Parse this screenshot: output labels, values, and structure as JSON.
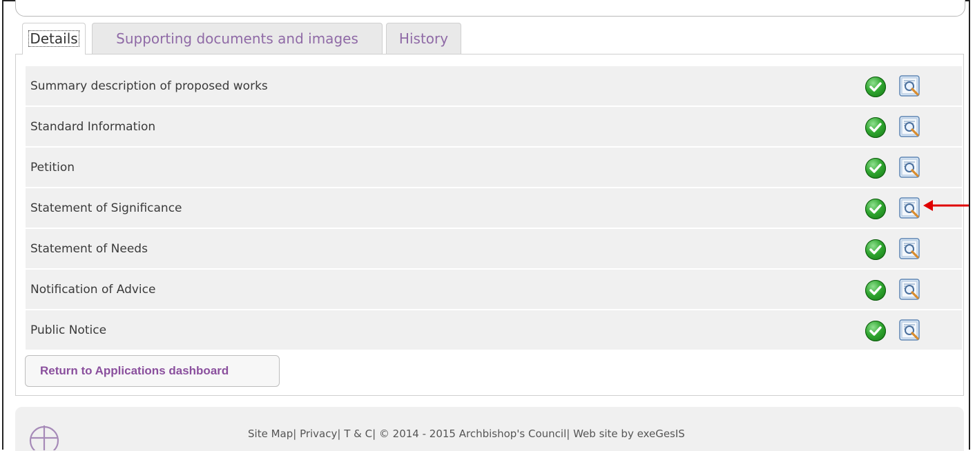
{
  "tabs": [
    {
      "label": "Details",
      "active": true
    },
    {
      "label": "Supporting documents and images",
      "active": false
    },
    {
      "label": "History",
      "active": false
    }
  ],
  "sections": [
    {
      "label": "Summary description of proposed works",
      "status": "complete"
    },
    {
      "label": "Standard Information",
      "status": "complete"
    },
    {
      "label": "Petition",
      "status": "complete"
    },
    {
      "label": "Statement of Significance",
      "status": "complete"
    },
    {
      "label": "Statement of Needs",
      "status": "complete"
    },
    {
      "label": "Notification of Advice",
      "status": "complete"
    },
    {
      "label": "Public Notice",
      "status": "complete"
    }
  ],
  "actions": {
    "return_label": "Return to Applications dashboard"
  },
  "footer": {
    "site_map": "Site Map",
    "privacy": "Privacy",
    "terms": "T & C",
    "copyright": "© 2014 - 2015 Archbishop's Council",
    "credit": "Web site by exeGesIS",
    "separator": "| "
  },
  "icons": {
    "status": "check-circle-icon",
    "view": "document-magnifier-icon",
    "annotation": "red-arrow-left-icon",
    "logo": "church-cross-logo-icon"
  },
  "colors": {
    "tab_inactive_text": "#8f6aa6",
    "button_text": "#8a4f9d",
    "row_background": "#f0f0f0",
    "check_green": "#2fa52f",
    "annotation_red": "#e00000"
  }
}
